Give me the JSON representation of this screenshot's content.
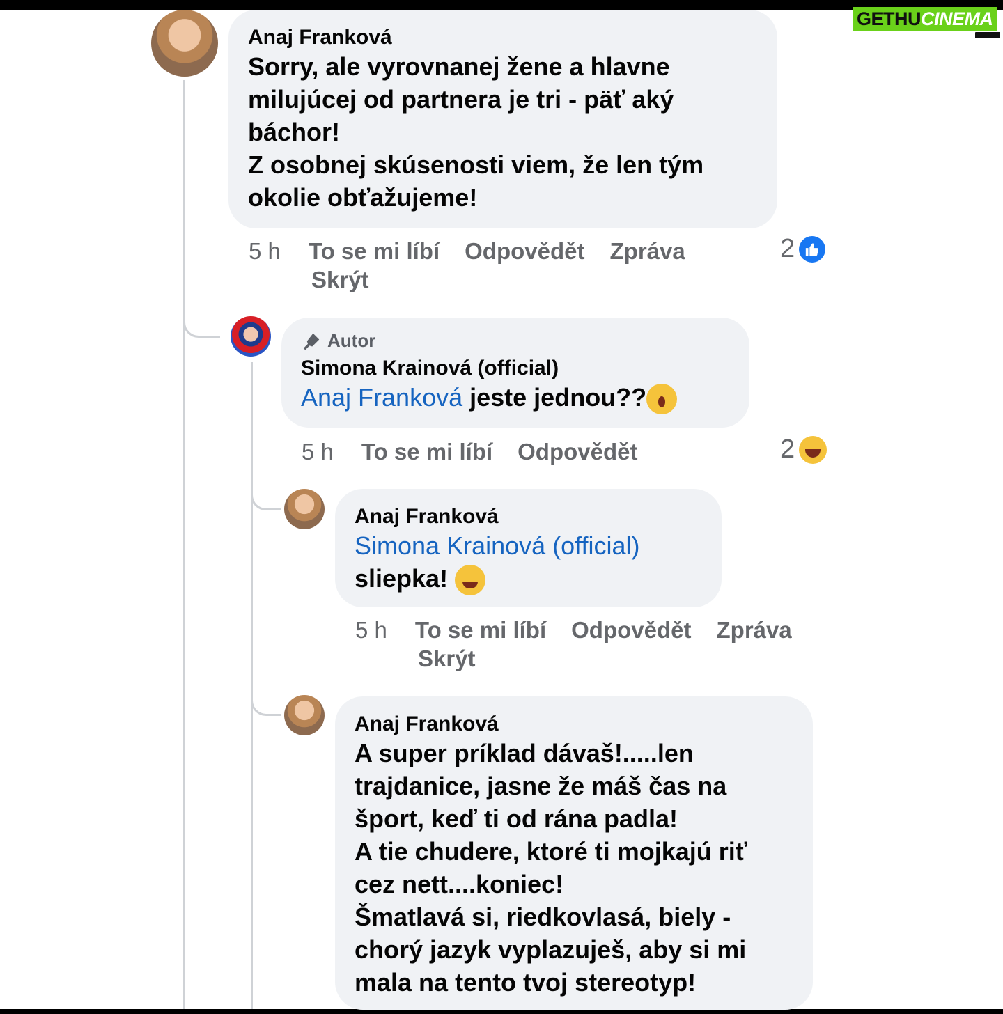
{
  "watermark": {
    "part1": "GETHU",
    "part2": "CINEMA"
  },
  "comments": [
    {
      "author": "Anaj Franková",
      "text_lines": [
        "Sorry, ale vyrovnanej žene a hlavne",
        "milujúcej od partnera je tri - päť aký",
        "báchor!",
        "Z osobnej skúsenosti viem, že len tým",
        "okolie obťažujeme!"
      ],
      "time": "5 h",
      "actions": [
        "To se mi líbí",
        "Odpovědět",
        "Zpráva",
        "Skrýt"
      ],
      "reaction_count": "2",
      "reaction_type": "like"
    },
    {
      "badge": "Autor",
      "author": "Simona Krainová (official)",
      "mention": "Anaj Franková",
      "text": " jeste jednou??",
      "time": "5 h",
      "actions": [
        "To se mi líbí",
        "Odpovědět"
      ],
      "reaction_count": "2",
      "reaction_type": "haha"
    },
    {
      "author": "Anaj Franková",
      "mention": "Simona Krainová (official)",
      "text": "sliepka! ",
      "time": "5 h",
      "actions": [
        "To se mi líbí",
        "Odpovědět",
        "Zpráva",
        "Skrýt"
      ]
    },
    {
      "author": "Anaj Franková",
      "text_lines": [
        "A super príklad dávaš!.....len",
        "trajdanice, jasne že máš čas na",
        "šport, keď ti od rána padla!",
        "A tie chudere, ktoré ti mojkajú riť",
        "cez nett....koniec!",
        "Šmatlavá si, riedkovlasá, biely -",
        "chorý jazyk vyplazuješ, aby si mi",
        "mala na tento tvoj stereotyp!"
      ]
    }
  ]
}
